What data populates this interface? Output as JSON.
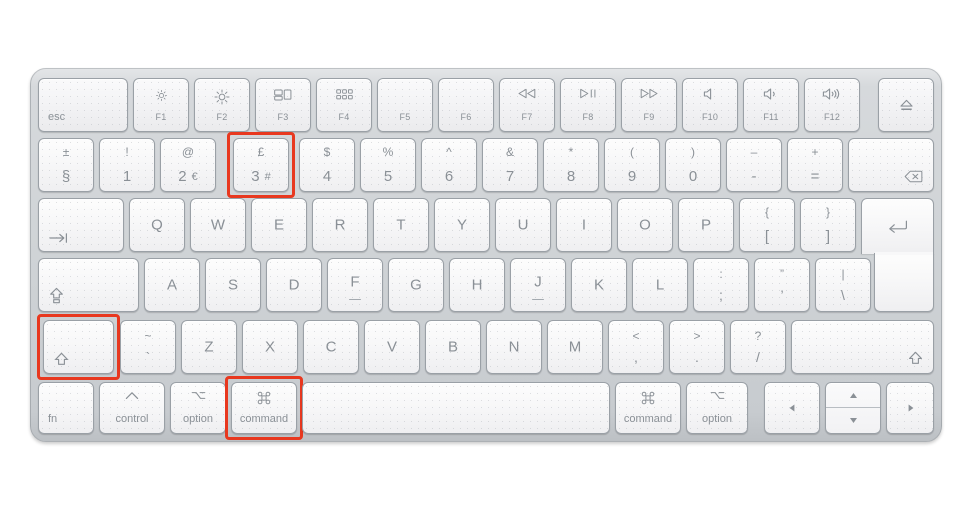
{
  "device": {
    "name": "apple-magic-keyboard",
    "layout": "UK ISO",
    "frame_color": "#d2d6d9",
    "key_color": "#f7f7f8",
    "label_color": "#8a9096",
    "highlight_color": "#e8381f"
  },
  "highlighted_keys": [
    "3",
    "shift-left",
    "command-left"
  ],
  "rows": {
    "function_row": [
      {
        "id": "esc",
        "label": "esc",
        "icon": ""
      },
      {
        "id": "f1",
        "label": "F1",
        "icon": "brightness-down-icon"
      },
      {
        "id": "f2",
        "label": "F2",
        "icon": "brightness-up-icon"
      },
      {
        "id": "f3",
        "label": "F3",
        "icon": "mission-control-icon"
      },
      {
        "id": "f4",
        "label": "F4",
        "icon": "launchpad-icon"
      },
      {
        "id": "f5",
        "label": "F5",
        "icon": ""
      },
      {
        "id": "f6",
        "label": "F6",
        "icon": ""
      },
      {
        "id": "f7",
        "label": "F7",
        "icon": "rewind-icon"
      },
      {
        "id": "f8",
        "label": "F8",
        "icon": "play-pause-icon"
      },
      {
        "id": "f9",
        "label": "F9",
        "icon": "fast-forward-icon"
      },
      {
        "id": "f10",
        "label": "F10",
        "icon": "mute-icon"
      },
      {
        "id": "f11",
        "label": "F11",
        "icon": "volume-down-icon"
      },
      {
        "id": "f12",
        "label": "F12",
        "icon": "volume-up-icon"
      },
      {
        "id": "eject",
        "label": "",
        "icon": "eject-icon"
      }
    ],
    "number_row": [
      {
        "id": "section",
        "upper": "±",
        "lower": "§",
        "alt": ""
      },
      {
        "id": "1",
        "upper": "!",
        "lower": "1",
        "alt": ""
      },
      {
        "id": "2",
        "upper": "@",
        "lower": "2",
        "alt": "€"
      },
      {
        "id": "3",
        "upper": "£",
        "lower": "3",
        "alt": "#"
      },
      {
        "id": "4",
        "upper": "$",
        "lower": "4",
        "alt": ""
      },
      {
        "id": "5",
        "upper": "%",
        "lower": "5",
        "alt": ""
      },
      {
        "id": "6",
        "upper": "^",
        "lower": "6",
        "alt": ""
      },
      {
        "id": "7",
        "upper": "&",
        "lower": "7",
        "alt": ""
      },
      {
        "id": "8",
        "upper": "*",
        "lower": "8",
        "alt": ""
      },
      {
        "id": "9",
        "upper": "(",
        "lower": "9",
        "alt": ""
      },
      {
        "id": "0",
        "upper": ")",
        "lower": "0",
        "alt": ""
      },
      {
        "id": "minus",
        "upper": "–",
        "lower": "-",
        "alt": ""
      },
      {
        "id": "equal",
        "upper": "+",
        "lower": "=",
        "alt": ""
      },
      {
        "id": "delete",
        "upper": "",
        "lower": "",
        "alt": "",
        "icon": "delete-backward-icon"
      }
    ],
    "qwerty_row": [
      {
        "id": "tab",
        "label": "",
        "icon": "tab-icon"
      },
      {
        "id": "q",
        "label": "Q"
      },
      {
        "id": "w",
        "label": "W"
      },
      {
        "id": "e",
        "label": "E"
      },
      {
        "id": "r",
        "label": "R"
      },
      {
        "id": "t",
        "label": "T"
      },
      {
        "id": "y",
        "label": "Y"
      },
      {
        "id": "u",
        "label": "U"
      },
      {
        "id": "i",
        "label": "I"
      },
      {
        "id": "o",
        "label": "O"
      },
      {
        "id": "p",
        "label": "P"
      },
      {
        "id": "bracket-left",
        "upper": "{",
        "lower": "["
      },
      {
        "id": "bracket-right",
        "upper": "}",
        "lower": "]"
      },
      {
        "id": "return",
        "label": "",
        "icon": "return-icon"
      }
    ],
    "home_row": [
      {
        "id": "capslock",
        "label": "",
        "icon": "caps-lock-icon"
      },
      {
        "id": "a",
        "label": "A"
      },
      {
        "id": "s",
        "label": "S"
      },
      {
        "id": "d",
        "label": "D"
      },
      {
        "id": "f",
        "label": "F",
        "homing": true
      },
      {
        "id": "g",
        "label": "G"
      },
      {
        "id": "h",
        "label": "H"
      },
      {
        "id": "j",
        "label": "J",
        "homing": true
      },
      {
        "id": "k",
        "label": "K"
      },
      {
        "id": "l",
        "label": "L"
      },
      {
        "id": "semicolon",
        "upper": ":",
        "lower": ";"
      },
      {
        "id": "quote",
        "upper": "”",
        "lower": "’"
      },
      {
        "id": "backslash",
        "upper": "|",
        "lower": "\\"
      }
    ],
    "shift_row": [
      {
        "id": "shift-left",
        "label": "",
        "icon": "shift-icon"
      },
      {
        "id": "backtick",
        "upper": "~",
        "lower": "`"
      },
      {
        "id": "z",
        "label": "Z"
      },
      {
        "id": "x",
        "label": "X"
      },
      {
        "id": "c",
        "label": "C"
      },
      {
        "id": "v",
        "label": "V"
      },
      {
        "id": "b",
        "label": "B"
      },
      {
        "id": "n",
        "label": "N"
      },
      {
        "id": "m",
        "label": "M"
      },
      {
        "id": "comma",
        "upper": "<",
        "lower": ","
      },
      {
        "id": "period",
        "upper": ">",
        "lower": "."
      },
      {
        "id": "slash",
        "upper": "?",
        "lower": "/"
      },
      {
        "id": "shift-right",
        "label": "",
        "icon": "shift-icon"
      }
    ],
    "bottom_row": [
      {
        "id": "fn",
        "label": "fn",
        "icon": ""
      },
      {
        "id": "control",
        "label": "control",
        "icon": "control-icon"
      },
      {
        "id": "option-left",
        "label": "option",
        "icon": "option-icon"
      },
      {
        "id": "command-left",
        "label": "command",
        "icon": "command-icon"
      },
      {
        "id": "space",
        "label": "",
        "icon": ""
      },
      {
        "id": "command-right",
        "label": "command",
        "icon": "command-icon"
      },
      {
        "id": "option-right",
        "label": "option",
        "icon": "option-icon"
      },
      {
        "id": "arrow-left",
        "label": "",
        "icon": "arrow-left-icon"
      },
      {
        "id": "arrow-up",
        "label": "",
        "icon": "arrow-up-icon"
      },
      {
        "id": "arrow-down",
        "label": "",
        "icon": "arrow-down-icon"
      },
      {
        "id": "arrow-right",
        "label": "",
        "icon": "arrow-right-icon"
      }
    ]
  }
}
